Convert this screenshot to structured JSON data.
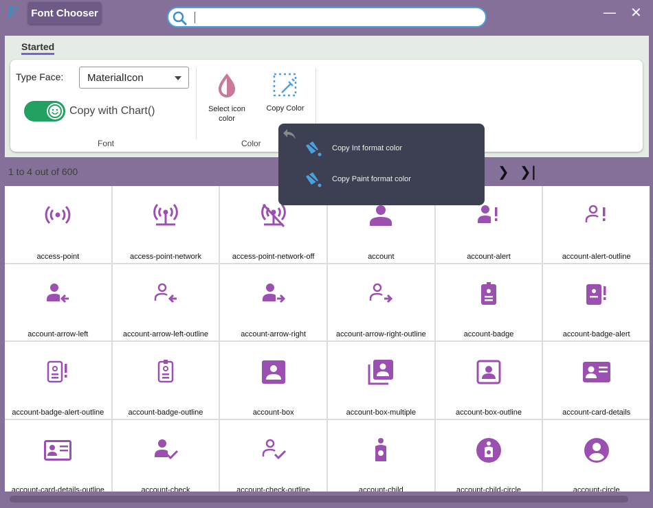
{
  "app": {
    "logo": "F",
    "title": "Font Chooser"
  },
  "search": {
    "value": "",
    "placeholder": ""
  },
  "ribbon": {
    "tab": "Started",
    "typeface_label": "Type Face:",
    "typeface_value": "MaterialIcon",
    "toggle_label": "Copy with Chart()",
    "toggle_on": true,
    "font_group": "Font",
    "color_group": "Color",
    "select_icon_color_l1": "Select icon",
    "select_icon_color_l2": "color",
    "copy_color": "Copy Color"
  },
  "popup": {
    "items": [
      "Copy Int  format color",
      "Copy Paint format color"
    ]
  },
  "status": "1 to 4 out of 600",
  "colors": {
    "icon": "#9b4fb0",
    "accent": "#7b5fd6",
    "toggle": "#22a060"
  },
  "icons": [
    {
      "name": "access-point",
      "glyph": "ap"
    },
    {
      "name": "access-point-network",
      "glyph": "apn"
    },
    {
      "name": "access-point-network-off",
      "glyph": "apnoff"
    },
    {
      "name": "account",
      "glyph": "acc"
    },
    {
      "name": "account-alert",
      "glyph": "accalert"
    },
    {
      "name": "account-alert-outline",
      "glyph": "accalerto"
    },
    {
      "name": "account-arrow-left",
      "glyph": "accleft"
    },
    {
      "name": "account-arrow-left-outline",
      "glyph": "acclefto"
    },
    {
      "name": "account-arrow-right",
      "glyph": "accright"
    },
    {
      "name": "account-arrow-right-outline",
      "glyph": "accrighto"
    },
    {
      "name": "account-badge",
      "glyph": "badge"
    },
    {
      "name": "account-badge-alert",
      "glyph": "badgealert"
    },
    {
      "name": "account-badge-alert-outline",
      "glyph": "badgealerto"
    },
    {
      "name": "account-badge-outline",
      "glyph": "badgeo"
    },
    {
      "name": "account-box",
      "glyph": "box"
    },
    {
      "name": "account-box-multiple",
      "glyph": "boxmulti"
    },
    {
      "name": "account-box-outline",
      "glyph": "boxo"
    },
    {
      "name": "account-card-details",
      "glyph": "card"
    },
    {
      "name": "account-card-details-outline",
      "glyph": "cardo"
    },
    {
      "name": "account-check",
      "glyph": "check"
    },
    {
      "name": "account-check-outline",
      "glyph": "checko"
    },
    {
      "name": "account-child",
      "glyph": "child"
    },
    {
      "name": "account-child-circle",
      "glyph": "childc"
    },
    {
      "name": "account-circle",
      "glyph": "circle"
    }
  ]
}
